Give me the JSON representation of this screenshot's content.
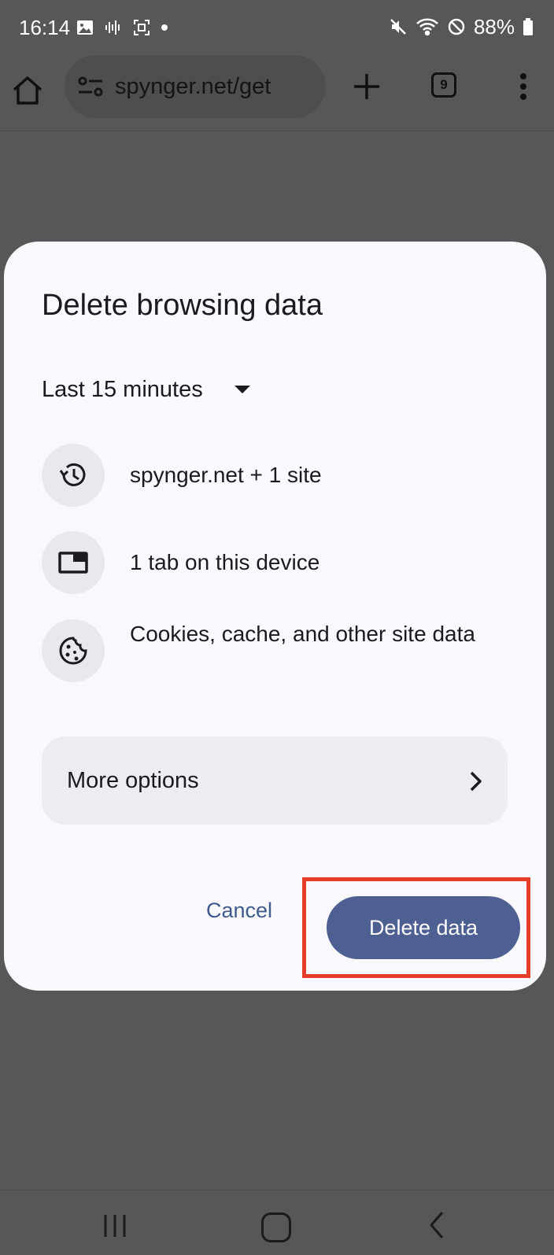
{
  "status_bar": {
    "time": "16:14",
    "battery": "88%",
    "left_icons": [
      "image-icon",
      "voice-icon",
      "screenshot-icon",
      "dot-icon"
    ],
    "right_icons": [
      "mute-icon",
      "wifi-icon",
      "no-disturb-icon",
      "battery-icon"
    ]
  },
  "browser": {
    "url": "spynger.net/get",
    "tab_count": "9"
  },
  "dialog": {
    "title": "Delete browsing data",
    "time_range": "Last 15 minutes",
    "items": [
      {
        "icon": "history-icon",
        "text": "spynger.net + 1 site"
      },
      {
        "icon": "tab-icon",
        "text": "1 tab on this device"
      },
      {
        "icon": "cookie-icon",
        "text": "Cookies, cache, and other site data"
      }
    ],
    "more_options": "More options",
    "cancel_label": "Cancel",
    "delete_label": "Delete data"
  },
  "colors": {
    "primary_button": "#4e5f91",
    "highlight": "#e63c2a",
    "scrim": "#575757"
  }
}
